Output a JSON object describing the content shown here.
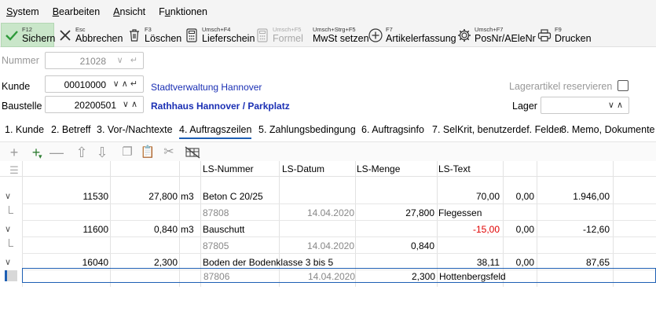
{
  "menu": [
    {
      "label": "System",
      "u": "S"
    },
    {
      "label": "Bearbeiten",
      "u": "B"
    },
    {
      "label": "Ansicht",
      "u": "A"
    },
    {
      "label": "Funktionen",
      "u": "u"
    }
  ],
  "toolbar": {
    "save": {
      "key": "F12",
      "label": "Sichern"
    },
    "cancel": {
      "key": "Esc",
      "label": "Abbrechen"
    },
    "delete": {
      "key": "F3",
      "label": "Löschen"
    },
    "delivery": {
      "key": "Umsch+F4",
      "label": "Lieferschein"
    },
    "formula": {
      "key": "Umsch+F5",
      "label": "Formel"
    },
    "vat": {
      "key": "Umsch+Strg+F5",
      "label": "MwSt setzen"
    },
    "article": {
      "key": "F7",
      "label": "Artikelerfassung"
    },
    "posnr": {
      "key": "Umsch+F7",
      "label": "PosNr/AEleNr"
    },
    "print": {
      "key": "F9",
      "label": "Drucken"
    }
  },
  "form": {
    "nummer_label": "Nummer",
    "nummer_value": "21028",
    "kunde_label": "Kunde",
    "kunde_value": "00010000",
    "kunde_name": "Stadtverwaltung Hannover",
    "baustelle_label": "Baustelle",
    "baustelle_value": "20200501",
    "baustelle_name": "Rathhaus Hannover / Parkplatz",
    "lagerartikel_label": "Lagerartikel reservieren",
    "lager_label": "Lager",
    "lager_value": ""
  },
  "tabs": [
    "1. Kunde",
    "2. Betreff",
    "3. Vor-/Nachtexte",
    "4. Auftragszeilen",
    "5. Zahlungsbedingung",
    "6. Auftragsinfo",
    "7. SelKrit, benutzerdef. Felder",
    "8. Memo, Dokumente"
  ],
  "grid": {
    "headers": [
      "LS-Nummer",
      "LS-Datum",
      "LS-Menge",
      "LS-Text"
    ],
    "rows": [
      {
        "type": "main",
        "article": "11530",
        "qty": "27,800",
        "unit": "m3",
        "text": "Beton C 20/25",
        "price": "70,00",
        "disc": "0,00",
        "total": "1.946,00",
        "price_red": false
      },
      {
        "type": "sub",
        "ls_nr": "87808",
        "ls_date": "14.04.2020",
        "ls_qty": "27,800",
        "ls_text": "Flegessen"
      },
      {
        "type": "main",
        "article": "11600",
        "qty": "0,840",
        "unit": "m3",
        "text": "Bauschutt",
        "price": "-15,00",
        "disc": "0,00",
        "total": "-12,60",
        "price_red": true
      },
      {
        "type": "sub",
        "ls_nr": "87805",
        "ls_date": "14.04.2020",
        "ls_qty": "0,840",
        "ls_text": ""
      },
      {
        "type": "main",
        "article": "16040",
        "qty": "2,300",
        "unit": "",
        "text": "Boden der Bodenklasse 3 bis 5",
        "price": "38,11",
        "disc": "0,00",
        "total": "87,65",
        "price_red": false
      },
      {
        "type": "sub",
        "ls_nr": "87806",
        "ls_date": "14.04.2020",
        "ls_qty": "2,300",
        "ls_text": "Hottenbergsfeld"
      }
    ]
  }
}
